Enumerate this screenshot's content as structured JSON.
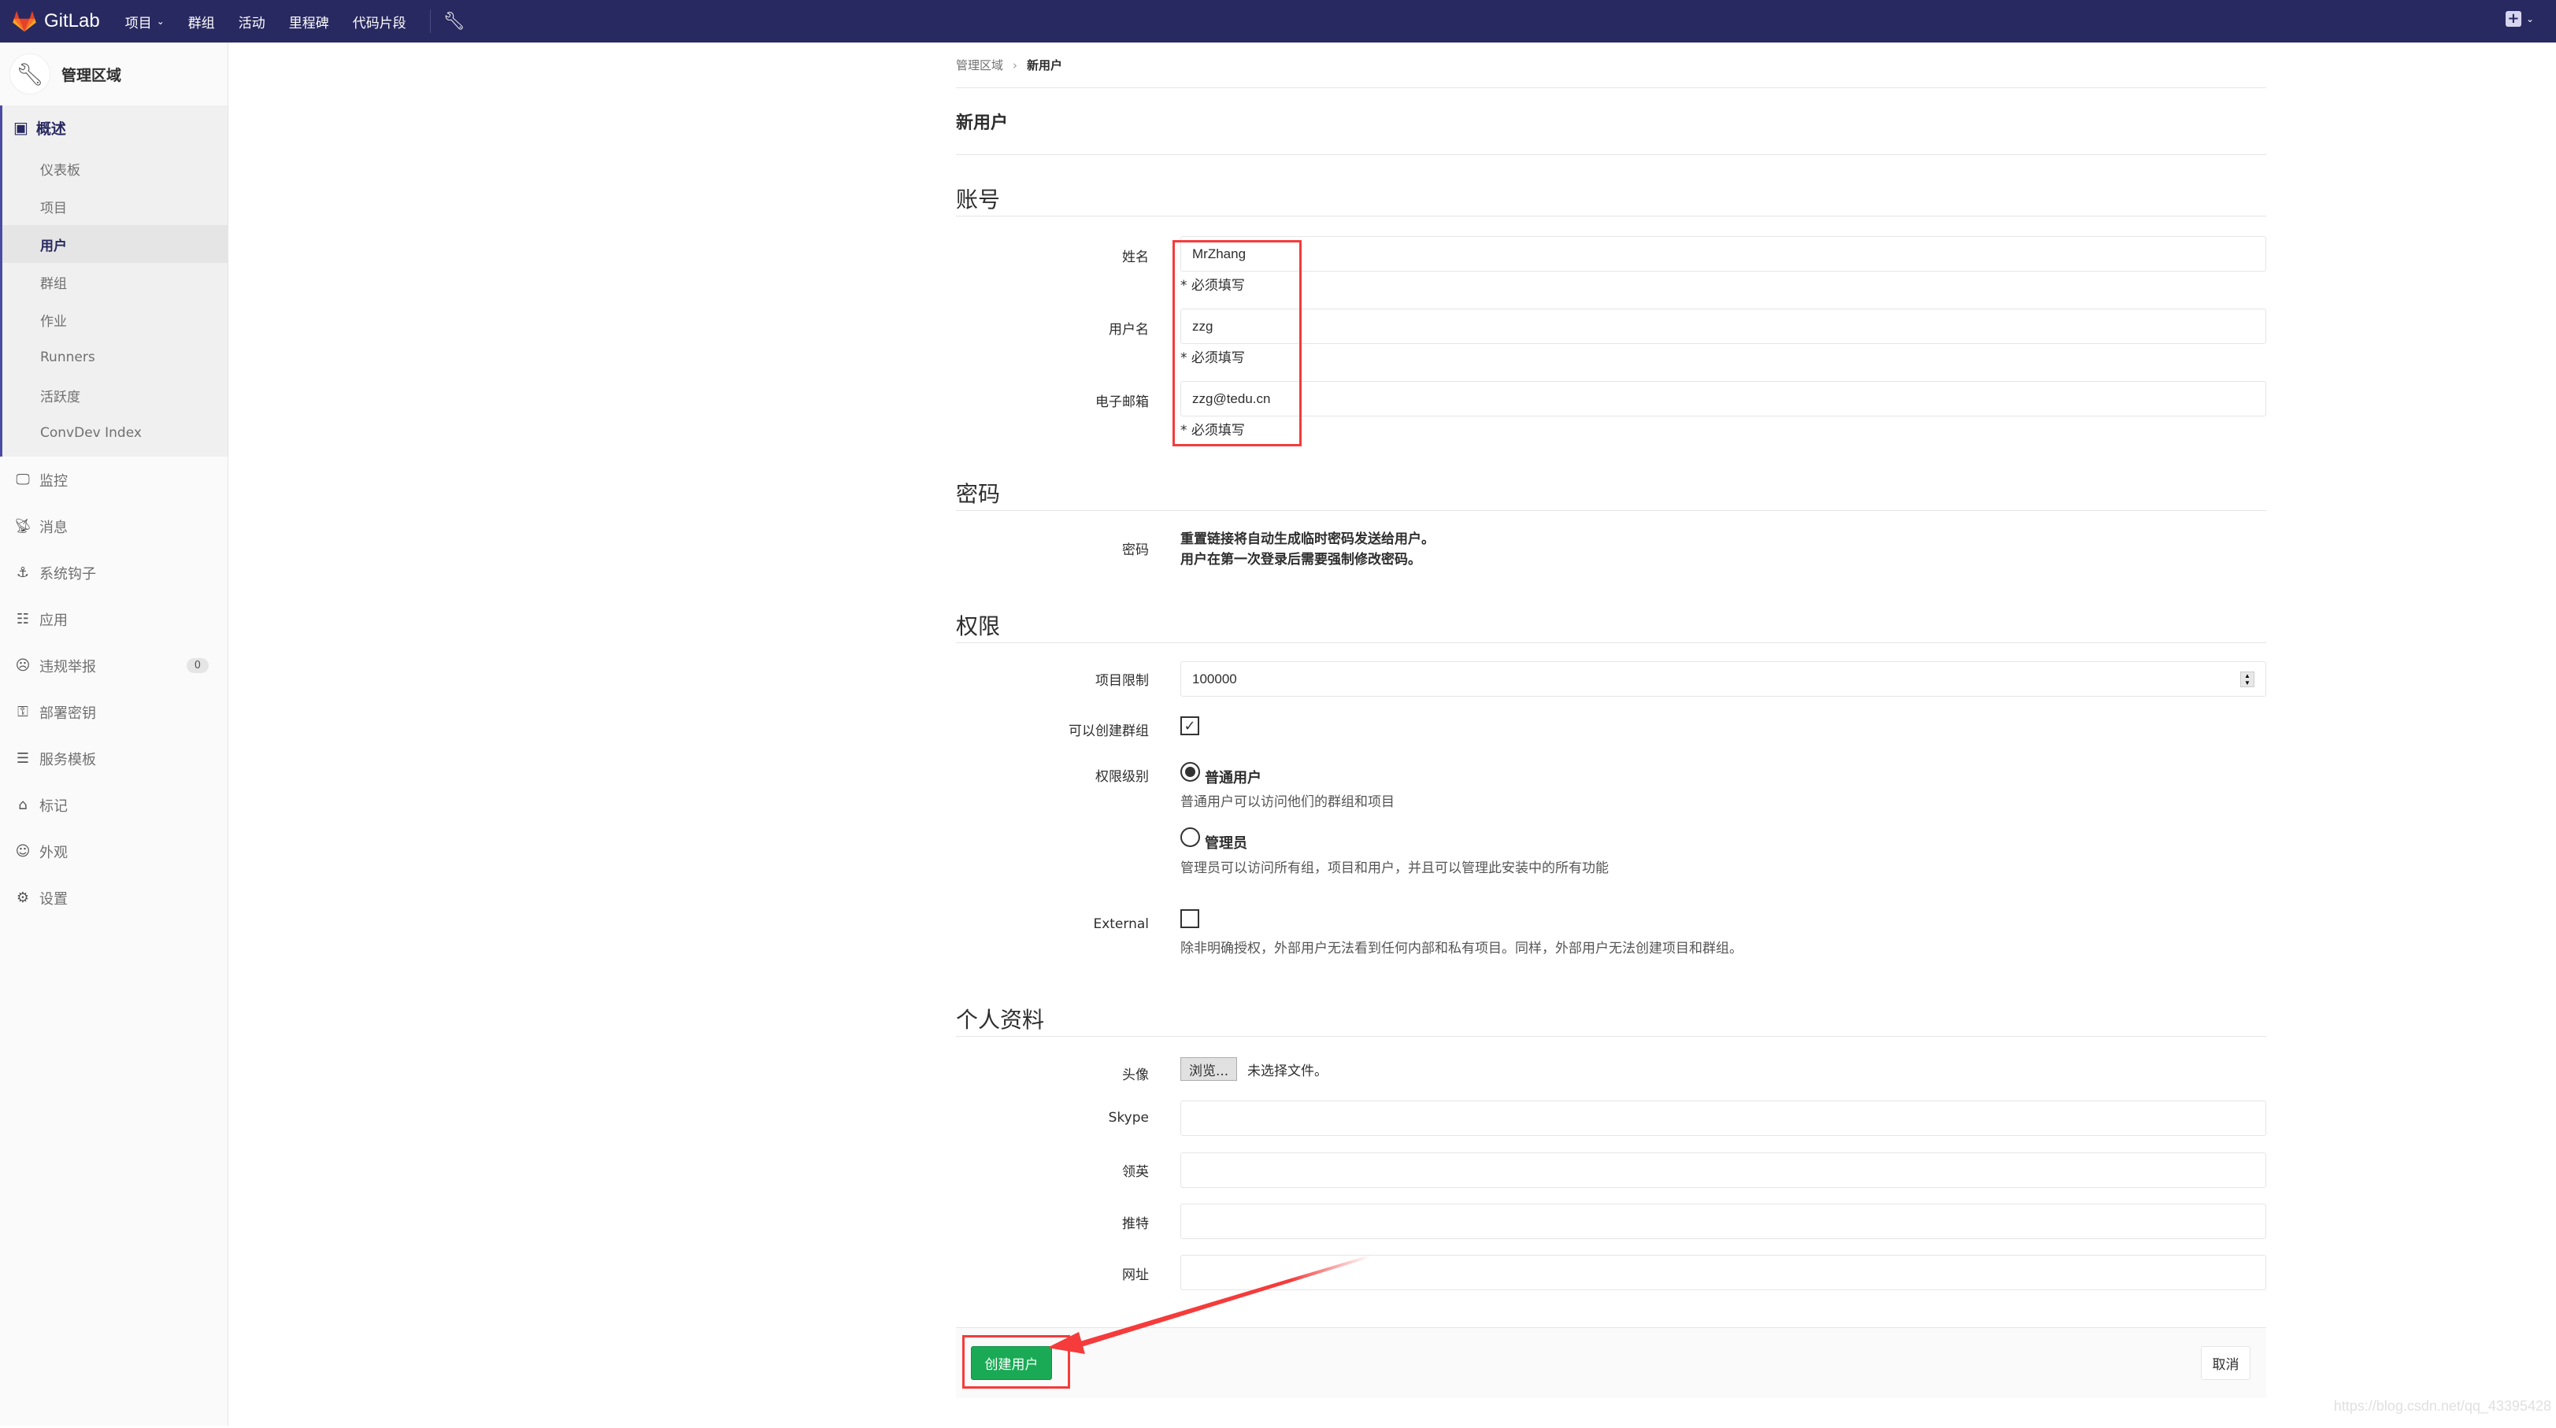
{
  "header": {
    "app_name": "GitLab",
    "nav": [
      {
        "label": "项目",
        "has_dropdown": true
      },
      {
        "label": "群组"
      },
      {
        "label": "活动"
      },
      {
        "label": "里程碑"
      },
      {
        "label": "代码片段"
      }
    ],
    "admin_icon": "wrench-icon",
    "new_icon": "plus-square-icon",
    "brand_color": "#292961"
  },
  "sidebar": {
    "title": "管理区域",
    "overview": {
      "label": "概述",
      "items": [
        {
          "label": "仪表板"
        },
        {
          "label": "项目"
        },
        {
          "label": "用户",
          "active": true
        },
        {
          "label": "群组"
        },
        {
          "label": "作业"
        },
        {
          "label": "Runners"
        },
        {
          "label": "活跃度"
        },
        {
          "label": "ConvDev Index"
        }
      ]
    },
    "items": [
      {
        "label": "监控",
        "icon": "monitor-icon"
      },
      {
        "label": "消息",
        "icon": "broadcast-icon"
      },
      {
        "label": "系统钩子",
        "icon": "anchor-icon"
      },
      {
        "label": "应用",
        "icon": "grid-icon"
      },
      {
        "label": "违规举报",
        "icon": "frown-icon",
        "badge": "0"
      },
      {
        "label": "部署密钥",
        "icon": "key-icon"
      },
      {
        "label": "服务模板",
        "icon": "template-icon"
      },
      {
        "label": "标记",
        "icon": "label-icon"
      },
      {
        "label": "外观",
        "icon": "palette-icon"
      },
      {
        "label": "设置",
        "icon": "gear-icon"
      }
    ]
  },
  "breadcrumb": {
    "parent": "管理区域",
    "current": "新用户"
  },
  "page_title": "新用户",
  "sections": {
    "account": {
      "title": "账号",
      "name_label": "姓名",
      "name_value": "MrZhang",
      "username_label": "用户名",
      "username_value": "zzg",
      "email_label": "电子邮箱",
      "email_value": "zzg@tedu.cn",
      "required_hint": "* 必须填写"
    },
    "password": {
      "title": "密码",
      "label": "密码",
      "line1": "重置链接将自动生成临时密码发送给用户。",
      "line2": "用户在第一次登录后需要强制修改密码。"
    },
    "access": {
      "title": "权限",
      "projects_limit_label": "项目限制",
      "projects_limit_value": "100000",
      "can_create_group_label": "可以创建群组",
      "can_create_group_checked": true,
      "access_level_label": "权限级别",
      "regular_label": "普通用户",
      "regular_desc": "普通用户可以访问他们的群组和项目",
      "regular_selected": true,
      "admin_label": "管理员",
      "admin_desc": "管理员可以访问所有组，项目和用户，并且可以管理此安装中的所有功能",
      "admin_selected": false,
      "external_label": "External",
      "external_checked": false,
      "external_desc": "除非明确授权，外部用户无法看到任何内部和私有项目。同样，外部用户无法创建项目和群组。"
    },
    "profile": {
      "title": "个人资料",
      "avatar_label": "头像",
      "browse_label": "浏览...",
      "no_file": "未选择文件。",
      "skype_label": "Skype",
      "skype_value": "",
      "linkedin_label": "领英",
      "linkedin_value": "",
      "twitter_label": "推特",
      "twitter_value": "",
      "website_label": "网址",
      "website_value": ""
    }
  },
  "actions": {
    "create": "创建用户",
    "cancel": "取消",
    "create_color": "#1aaa55"
  },
  "annotation_color": "#f53b3b",
  "watermark": "https://blog.csdn.net/qq_43395428"
}
